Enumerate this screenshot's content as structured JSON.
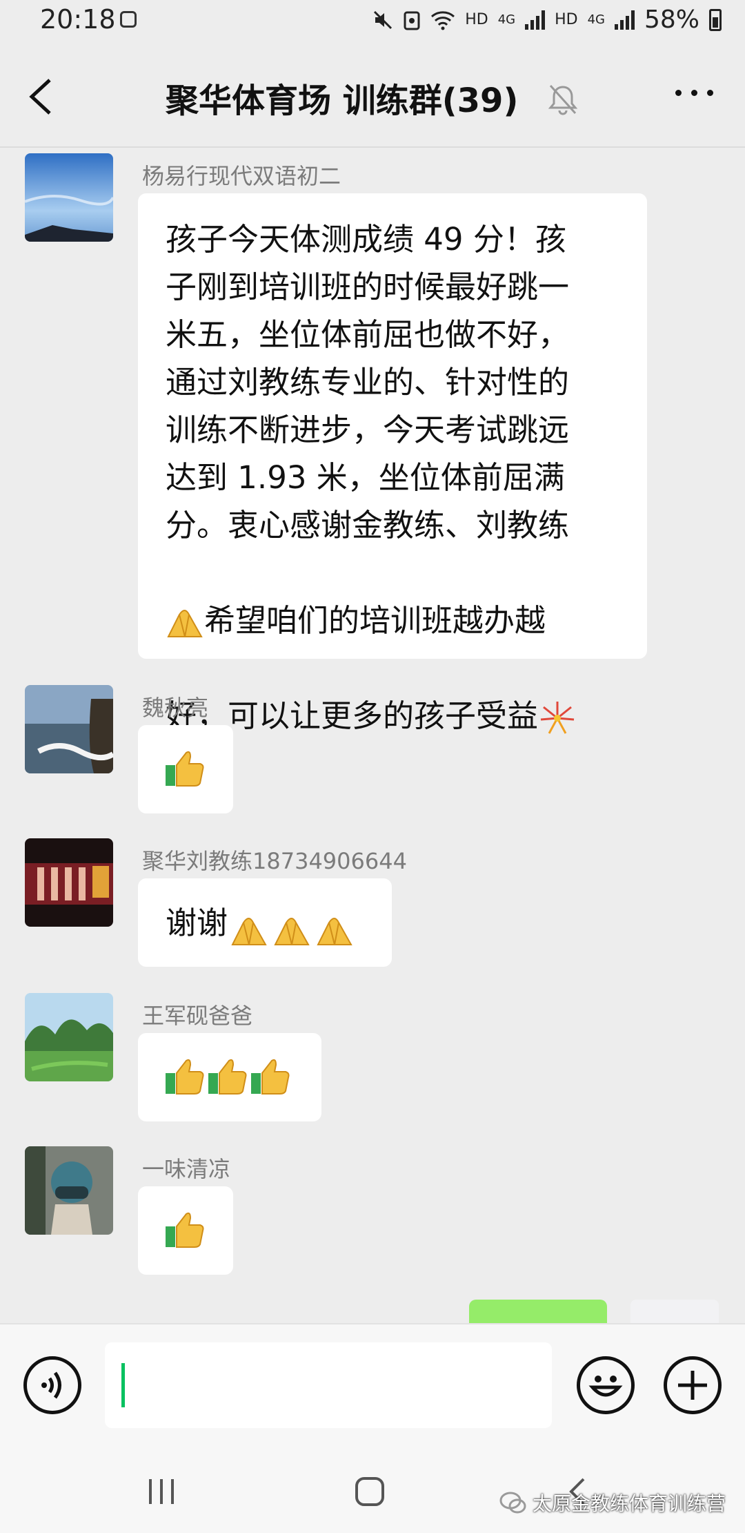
{
  "status_bar": {
    "time": "20:18",
    "battery": "58%",
    "network": [
      "HD",
      "4G",
      "HD",
      "4G"
    ]
  },
  "header": {
    "title": "聚华体育场  训练群(39)"
  },
  "messages": [
    {
      "sender": "杨易行现代双语初二",
      "text": "孩子今天体测成绩 49 分！孩\n子刚到培训班的时候最好跳一\n米五，坐位体前屈也做不好，\n通过刘教练专业的、针对性的\n训练不断进步，今天考试跳远\n达到 1.93 米，坐位体前屈满\n分。衷心感谢金教练、刘教练",
      "line8": "希望咱们的培训班越办越",
      "line9": "好，可以让更多的孩子受益"
    },
    {
      "sender": "魏秋亮",
      "emoji": [
        "thumbs-up"
      ]
    },
    {
      "sender": "聚华刘教练18734906644",
      "text": "谢谢",
      "emoji": [
        "folded-hands",
        "folded-hands",
        "folded-hands"
      ]
    },
    {
      "sender": "王军砚爸爸",
      "emoji": [
        "thumbs-up",
        "thumbs-up",
        "thumbs-up"
      ]
    },
    {
      "sender": "一味清凉",
      "emoji": [
        "thumbs-up"
      ]
    }
  ],
  "watermark": {
    "text": "太原金教练体育训练营"
  },
  "colors": {
    "accent": "#07c160",
    "bubble_self": "#95ec69",
    "background": "#ededed"
  }
}
